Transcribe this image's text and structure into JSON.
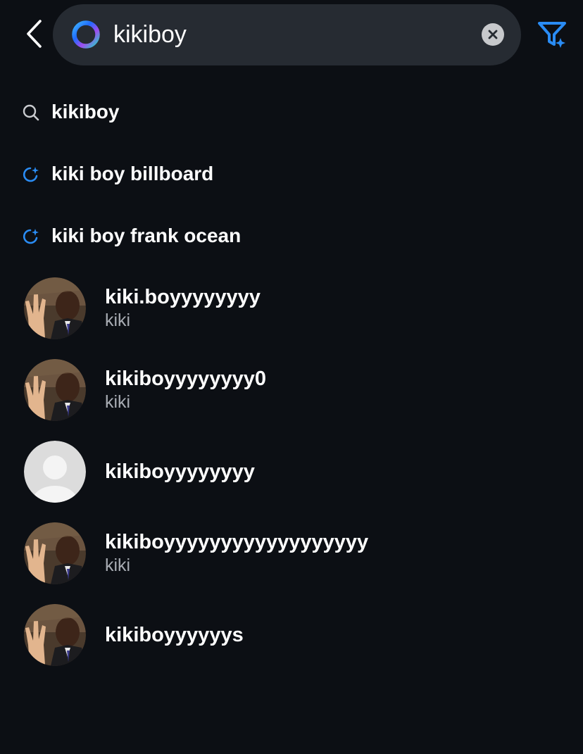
{
  "search": {
    "query": "kikiboy"
  },
  "icons": {
    "back": "chevron-left-icon",
    "logo": "meta-ai-ring-icon",
    "clear": "clear-x-icon",
    "filter": "filter-sparkle-icon",
    "search": "search-icon",
    "suggest": "ai-suggestion-icon"
  },
  "colors": {
    "background": "#0c0f14",
    "search_bar": "#262b32",
    "accent": "#2a8cf4",
    "secondary_text": "#a8acb3"
  },
  "suggestions": [
    {
      "label": "kikiboy",
      "icon": "search-icon"
    },
    {
      "label": "kiki boy billboard",
      "icon": "ai-suggestion-icon"
    },
    {
      "label": "kiki boy frank ocean",
      "icon": "ai-suggestion-icon"
    }
  ],
  "users": [
    {
      "username": "kiki.boyyyyyyyy",
      "name": "kiki",
      "avatar": "photo"
    },
    {
      "username": "kikiboyyyyyyyy0",
      "name": "kiki",
      "avatar": "photo"
    },
    {
      "username": "kikiboyyyyyyyy",
      "name": "",
      "avatar": "default"
    },
    {
      "username": "kikiboyyyyyyyyyyyyyyyyyy",
      "name": "kiki",
      "avatar": "photo"
    },
    {
      "username": "kikiboyyyyyys",
      "name": "",
      "avatar": "photo"
    }
  ]
}
